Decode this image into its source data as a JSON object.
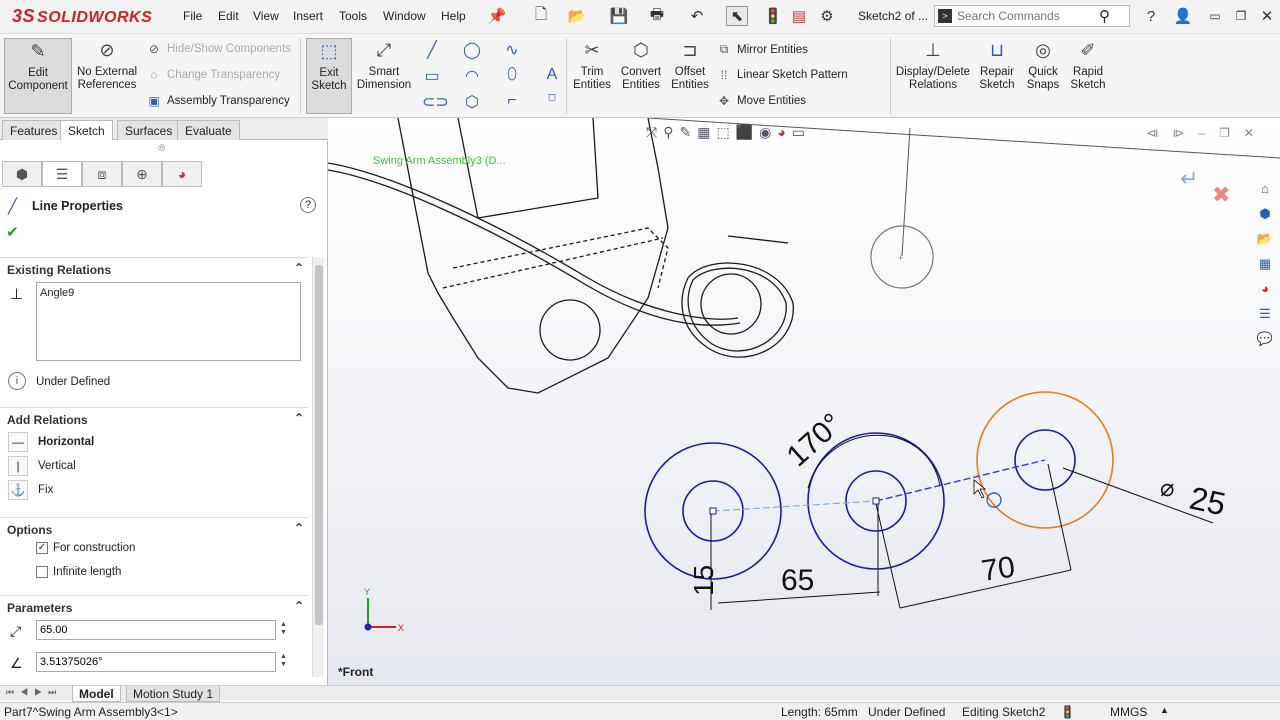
{
  "app": {
    "brand": "SOLIDWORKS",
    "brand_mark": "3S",
    "brand_color": "#d32027"
  },
  "menu": [
    "File",
    "Edit",
    "View",
    "Insert",
    "Tools",
    "Window",
    "Help"
  ],
  "doc_title": "Sketch2 of ...",
  "search": {
    "placeholder": "Search Commands"
  },
  "toolbar": {
    "edit_component": "Edit Component",
    "no_external_references": "No External References",
    "hide_show_components": "Hide/Show Components",
    "change_transparency": "Change Transparency",
    "assembly_transparency": "Assembly Transparency",
    "exit_sketch": "Exit Sketch",
    "smart_dimension": "Smart Dimension",
    "trim_entities": "Trim Entities",
    "convert_entities": "Convert Entities",
    "offset_entities": "Offset Entities",
    "mirror_entities": "Mirror Entities",
    "linear_sketch_pattern": "Linear Sketch Pattern",
    "move_entities": "Move Entities",
    "display_delete_relations": "Display/Delete Relations",
    "repair_sketch": "Repair Sketch",
    "quick_snaps": "Quick Snaps",
    "rapid_sketch": "Rapid Sketch"
  },
  "tabs": [
    "Features",
    "Sketch",
    "Surfaces",
    "Evaluate"
  ],
  "active_tab": "Sketch",
  "property_manager": {
    "title": "Line Properties",
    "existing_relations": {
      "header": "Existing Relations",
      "items": [
        "Angle9"
      ],
      "status": "Under Defined"
    },
    "add_relations": {
      "header": "Add Relations",
      "items": [
        "Horizontal",
        "Vertical",
        "Fix"
      ]
    },
    "options": {
      "header": "Options",
      "for_construction": {
        "label": "For construction",
        "checked": true
      },
      "infinite_length": {
        "label": "Infinite length",
        "checked": false
      }
    },
    "parameters": {
      "header": "Parameters",
      "length": "65.00",
      "angle": "3.51375026°"
    }
  },
  "viewport": {
    "assembly_label": "Swing Arm Assembly3 (D...",
    "view_name": "*Front",
    "triad": {
      "x": "X",
      "y": "Y"
    },
    "dimensions": {
      "angle": "170°",
      "diameter": "25",
      "diameter_symbol": "⌀",
      "d15": "15",
      "d65": "65",
      "d70": "70"
    }
  },
  "bottom_tabs": [
    "Model",
    "Motion Study 1"
  ],
  "active_bottom_tab": "Model",
  "status_bar": {
    "path": "Part7^Swing Arm Assembly3<1>",
    "length": "Length: 65mm",
    "definition": "Under Defined",
    "editing": "Editing Sketch2",
    "units": "MMGS"
  },
  "colors": {
    "sketch_blue": "#1a1aa8",
    "selected_orange": "#e87a1e",
    "construction_line": "#3b6fd6",
    "dimension_black": "#111111"
  }
}
